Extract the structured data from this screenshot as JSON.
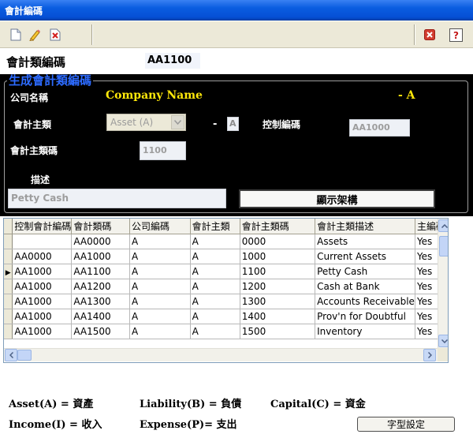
{
  "window": {
    "title": "會計編碼"
  },
  "toolbar": {
    "new_icon": "new-document-icon",
    "edit_icon": "pencil-icon",
    "delete_icon": "delete-icon",
    "close_icon": "close-icon",
    "help_icon": "help-icon",
    "help_label": "?"
  },
  "header": {
    "label": "會計類編碼",
    "value": "AA1100"
  },
  "form": {
    "group_title": "生成會計類編碼",
    "company_label": "公司名稱",
    "company_name": "Company Name",
    "company_suffix": "- A",
    "main_type_label": "會計主類",
    "main_type_value": "Asset  (A)",
    "dash": "-",
    "main_type_letter": "A",
    "control_code_label": "控制編碼",
    "control_code_value": "AA1000",
    "main_code_label": "會計主類碼",
    "main_code_value": "1100",
    "desc_label": "描述",
    "desc_value": "Petty Cash",
    "show_button": "顯示架構"
  },
  "grid": {
    "columns": [
      "控制會計編碼",
      "會計類碼",
      "公司編碼",
      "會計主類",
      "會計主類碼",
      "會計主類描述",
      "主編碼"
    ],
    "current_row_marker": "▶",
    "rows": [
      [
        "",
        "AA0000",
        "A",
        "A",
        "0000",
        "Assets",
        "Yes"
      ],
      [
        "AA0000",
        "AA1000",
        "A",
        "A",
        "1000",
        "Current Assets",
        "Yes"
      ],
      [
        "AA1000",
        "AA1100",
        "A",
        "A",
        "1100",
        "Petty Cash",
        "Yes"
      ],
      [
        "AA1000",
        "AA1200",
        "A",
        "A",
        "1200",
        "Cash at Bank",
        "Yes"
      ],
      [
        "AA1000",
        "AA1300",
        "A",
        "A",
        "1300",
        "Accounts Receivable",
        "Yes"
      ],
      [
        "AA1000",
        "AA1400",
        "A",
        "A",
        "1400",
        "Prov'n for Doubtful",
        "Yes"
      ],
      [
        "AA1000",
        "AA1500",
        "A",
        "A",
        "1500",
        "Inventory",
        "Yes"
      ]
    ],
    "current_row": 2
  },
  "legend": {
    "asset": "Asset(A) = 資產",
    "liability": "Liability(B) = 負債",
    "capital": "Capital(C) = 資金",
    "income": "Income(I) = 收入",
    "expense": "Expense(P)= 支出"
  },
  "font_button": "字型設定"
}
